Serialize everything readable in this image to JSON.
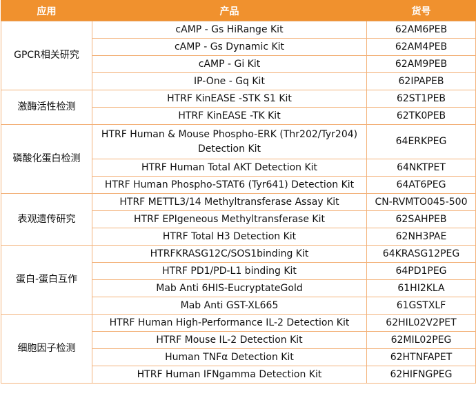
{
  "header": {
    "application": "应用",
    "product": "产品",
    "sku": "货号"
  },
  "groups": [
    {
      "name": "GPCR相关研究",
      "rows": [
        {
          "product": "cAMP - Gs HiRange Kit",
          "sku": "62AM6PEB"
        },
        {
          "product": "cAMP - Gs Dynamic Kit",
          "sku": "62AM4PEB"
        },
        {
          "product": "cAMP - Gi Kit",
          "sku": "62AM9PEB"
        },
        {
          "product": "IP-One - Gq Kit",
          "sku": "62IPAPEB"
        }
      ]
    },
    {
      "name": "激酶活性检测",
      "rows": [
        {
          "product": "HTRF KinEASE -STK S1 Kit",
          "sku": "62ST1PEB"
        },
        {
          "product": "HTRF KinEASE -TK Kit",
          "sku": "62TK0PEB"
        }
      ]
    },
    {
      "name": "磷酸化蛋白检测",
      "rows": [
        {
          "product": "HTRF Human & Mouse Phospho-ERK (Thr202/Tyr204) Detection Kit",
          "sku": "64ERKPEG"
        },
        {
          "product": "HTRF Human Total AKT Detection Kit",
          "sku": "64NKTPET"
        },
        {
          "product": "HTRF Human Phospho-STAT6 (Tyr641) Detection Kit",
          "sku": "64AT6PEG"
        }
      ]
    },
    {
      "name": "表观遗传研究",
      "rows": [
        {
          "product": "HTRF METTL3/14 Methyltransferase Assay Kit",
          "sku": "CN-RVMTO045-500"
        },
        {
          "product": "HTRF EPIgeneous Methyltransferase Kit",
          "sku": "62SAHPEB"
        },
        {
          "product": "HTRF Total H3 Detection Kit",
          "sku": "62NH3PAE"
        }
      ]
    },
    {
      "name": "蛋白-蛋白互作",
      "rows": [
        {
          "product": "HTRFKRASG12C/SOS1binding Kit",
          "sku": "64KRASG12PEG"
        },
        {
          "product": "HTRF PD1/PD-L1 binding Kit",
          "sku": "64PD1PEG"
        },
        {
          "product": "Mab Anti 6HIS-EucryptateGold",
          "sku": "61HI2KLA"
        },
        {
          "product": "Mab Anti GST-XL665",
          "sku": "61GSTXLF"
        }
      ]
    },
    {
      "name": "细胞因子检测",
      "rows": [
        {
          "product": "HTRF Human High-Performance IL-2 Detection Kit",
          "sku": "62HIL02V2PET"
        },
        {
          "product": "HTRF Mouse IL-2 Detection Kit",
          "sku": "62MIL02PEG"
        },
        {
          "product": "Human TNFα Detection Kit",
          "sku": "62HTNFAPET"
        },
        {
          "product": "HTRF Human IFNgamma Detection Kit",
          "sku": "62HIFNGPEG"
        }
      ]
    }
  ]
}
